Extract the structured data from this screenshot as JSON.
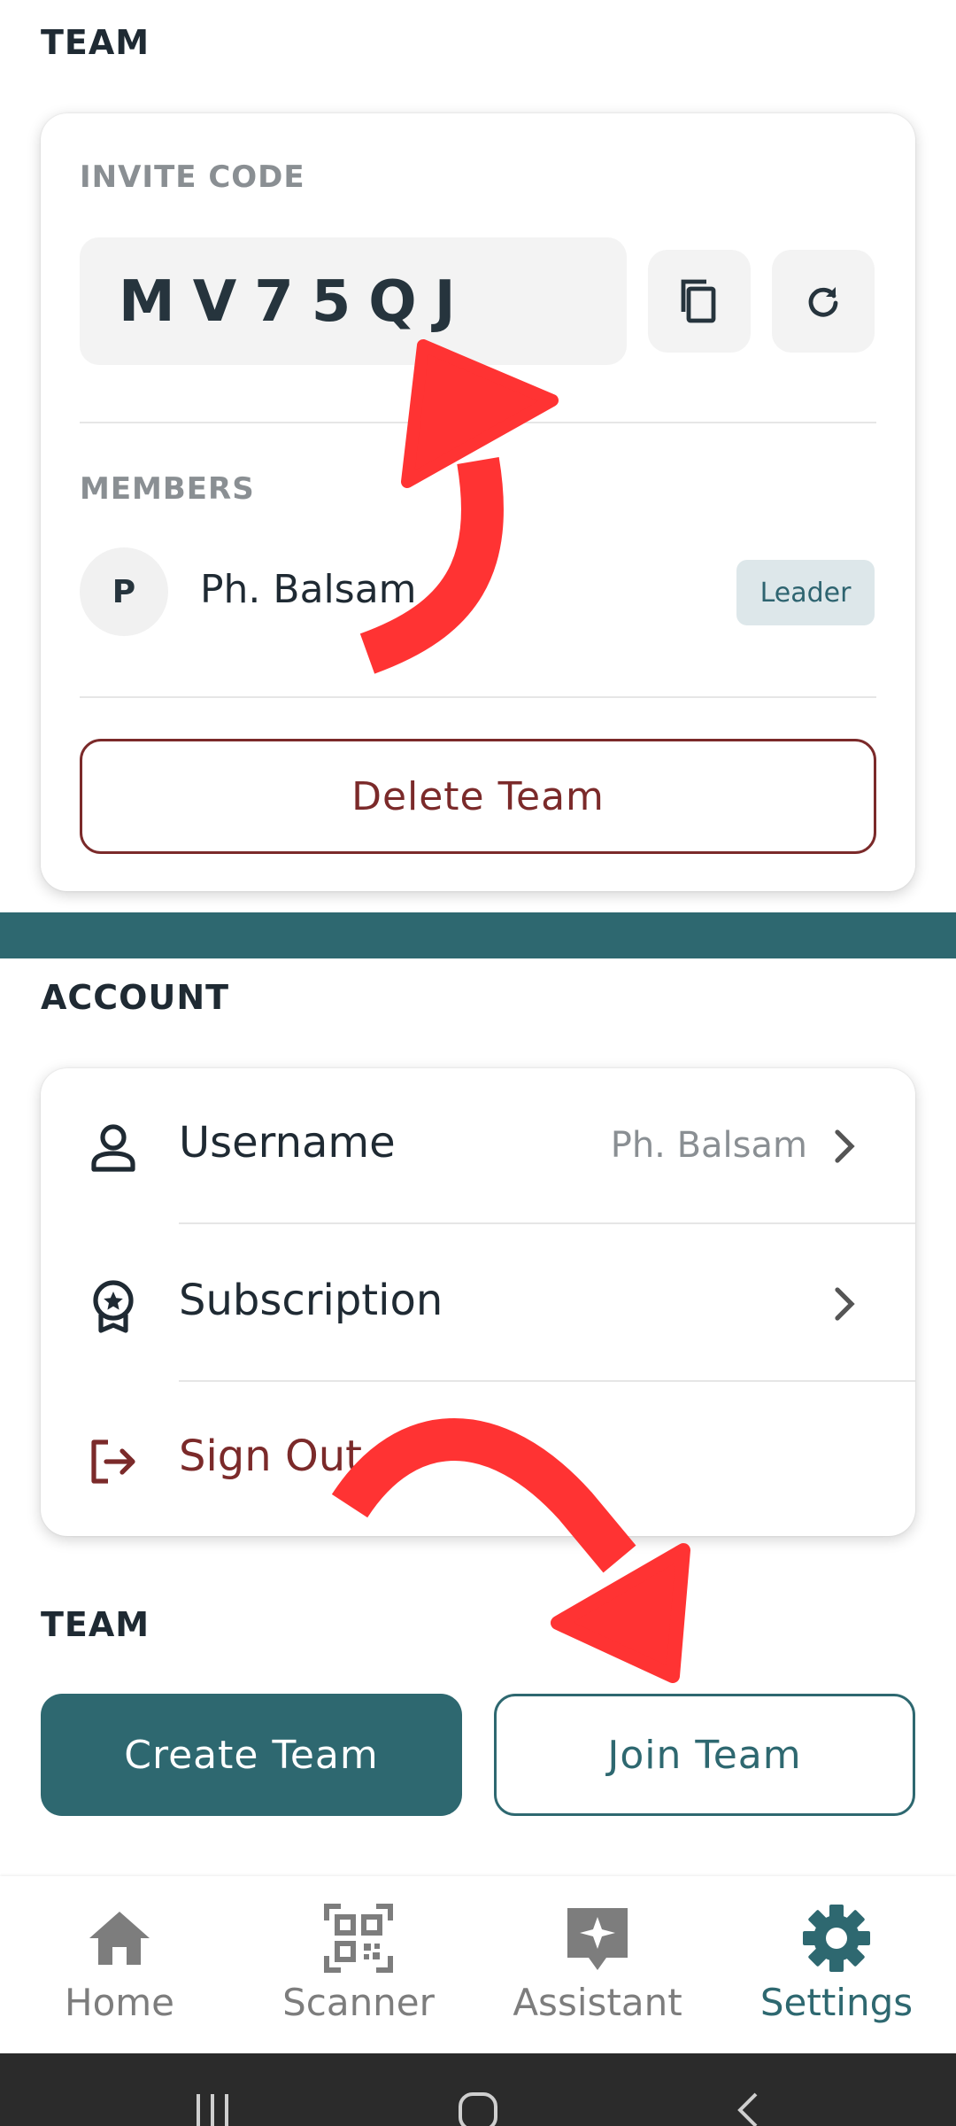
{
  "team_section": {
    "title": "TEAM",
    "invite_code_label": "INVITE CODE",
    "invite_code": "MV75QJ",
    "copy_icon": "copy-icon",
    "refresh_icon": "refresh-icon",
    "members_label": "MEMBERS",
    "members": [
      {
        "initial": "P",
        "name": "Ph. Balsam",
        "role": "Leader"
      }
    ],
    "delete_label": "Delete Team"
  },
  "account_section": {
    "title": "ACCOUNT",
    "items": [
      {
        "label": "Username",
        "value": "Ph. Balsam",
        "icon": "user-icon"
      },
      {
        "label": "Subscription",
        "value": "",
        "icon": "award-icon"
      },
      {
        "label": "Sign Out",
        "value": "",
        "icon": "sign-out-icon"
      }
    ]
  },
  "team_actions": {
    "title": "TEAM",
    "create_label": "Create Team",
    "join_label": "Join Team"
  },
  "bottom_nav": {
    "items": [
      {
        "label": "Home",
        "icon": "home-icon"
      },
      {
        "label": "Scanner",
        "icon": "qr-scanner-icon"
      },
      {
        "label": "Assistant",
        "icon": "assistant-icon"
      },
      {
        "label": "Settings",
        "icon": "gear-icon",
        "active": true
      }
    ]
  },
  "colors": {
    "accent": "#2e6870",
    "danger": "#7b2a2a",
    "annotation_arrow": "#ff3333"
  }
}
